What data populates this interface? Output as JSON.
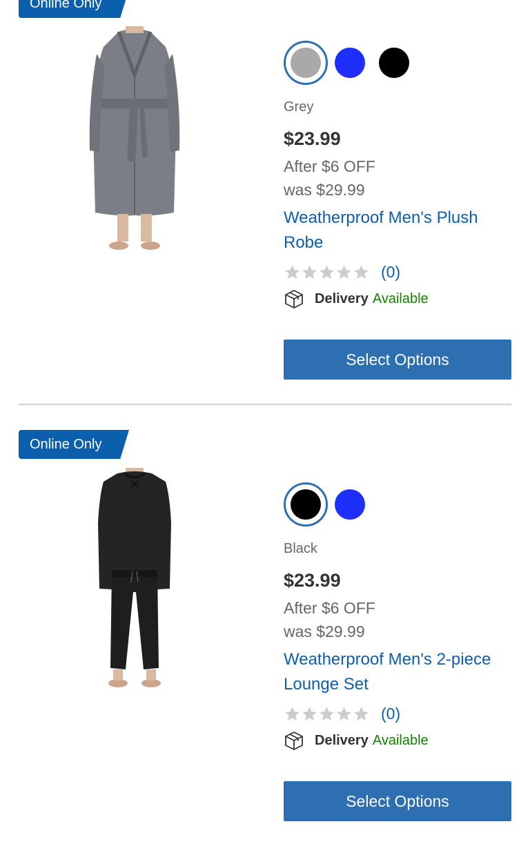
{
  "products": [
    {
      "badge": "Online Only",
      "image_icon": "robe-image",
      "swatches": [
        {
          "name": "Grey",
          "color": "#a9a9a9",
          "selected": true
        },
        {
          "name": "Blue",
          "color": "#1f2ffa",
          "selected": false
        },
        {
          "name": "Black",
          "color": "#000000",
          "selected": false
        }
      ],
      "color_label": "Grey",
      "price": "$23.99",
      "discount": "After $6 OFF",
      "was_price": "was $29.99",
      "title": "Weatherproof Men's Plush Robe",
      "rating_stars": 0,
      "rating_count": "(0)",
      "delivery_label": "Delivery",
      "delivery_status": "Available",
      "button_label": "Select Options"
    },
    {
      "badge": "Online Only",
      "image_icon": "lounge-set-image",
      "swatches": [
        {
          "name": "Black",
          "color": "#000000",
          "selected": true
        },
        {
          "name": "Blue",
          "color": "#1f2ffa",
          "selected": false
        }
      ],
      "color_label": "Black",
      "price": "$23.99",
      "discount": "After $6 OFF",
      "was_price": "was $29.99",
      "title": "Weatherproof Men's 2-piece Lounge Set",
      "rating_stars": 0,
      "rating_count": "(0)",
      "delivery_label": "Delivery",
      "delivery_status": "Available",
      "button_label": "Select Options"
    }
  ],
  "colors": {
    "brand_blue": "#0b5fad",
    "button_blue": "#2d6fb0",
    "available_green": "#138000",
    "star_empty": "#cccccc"
  }
}
